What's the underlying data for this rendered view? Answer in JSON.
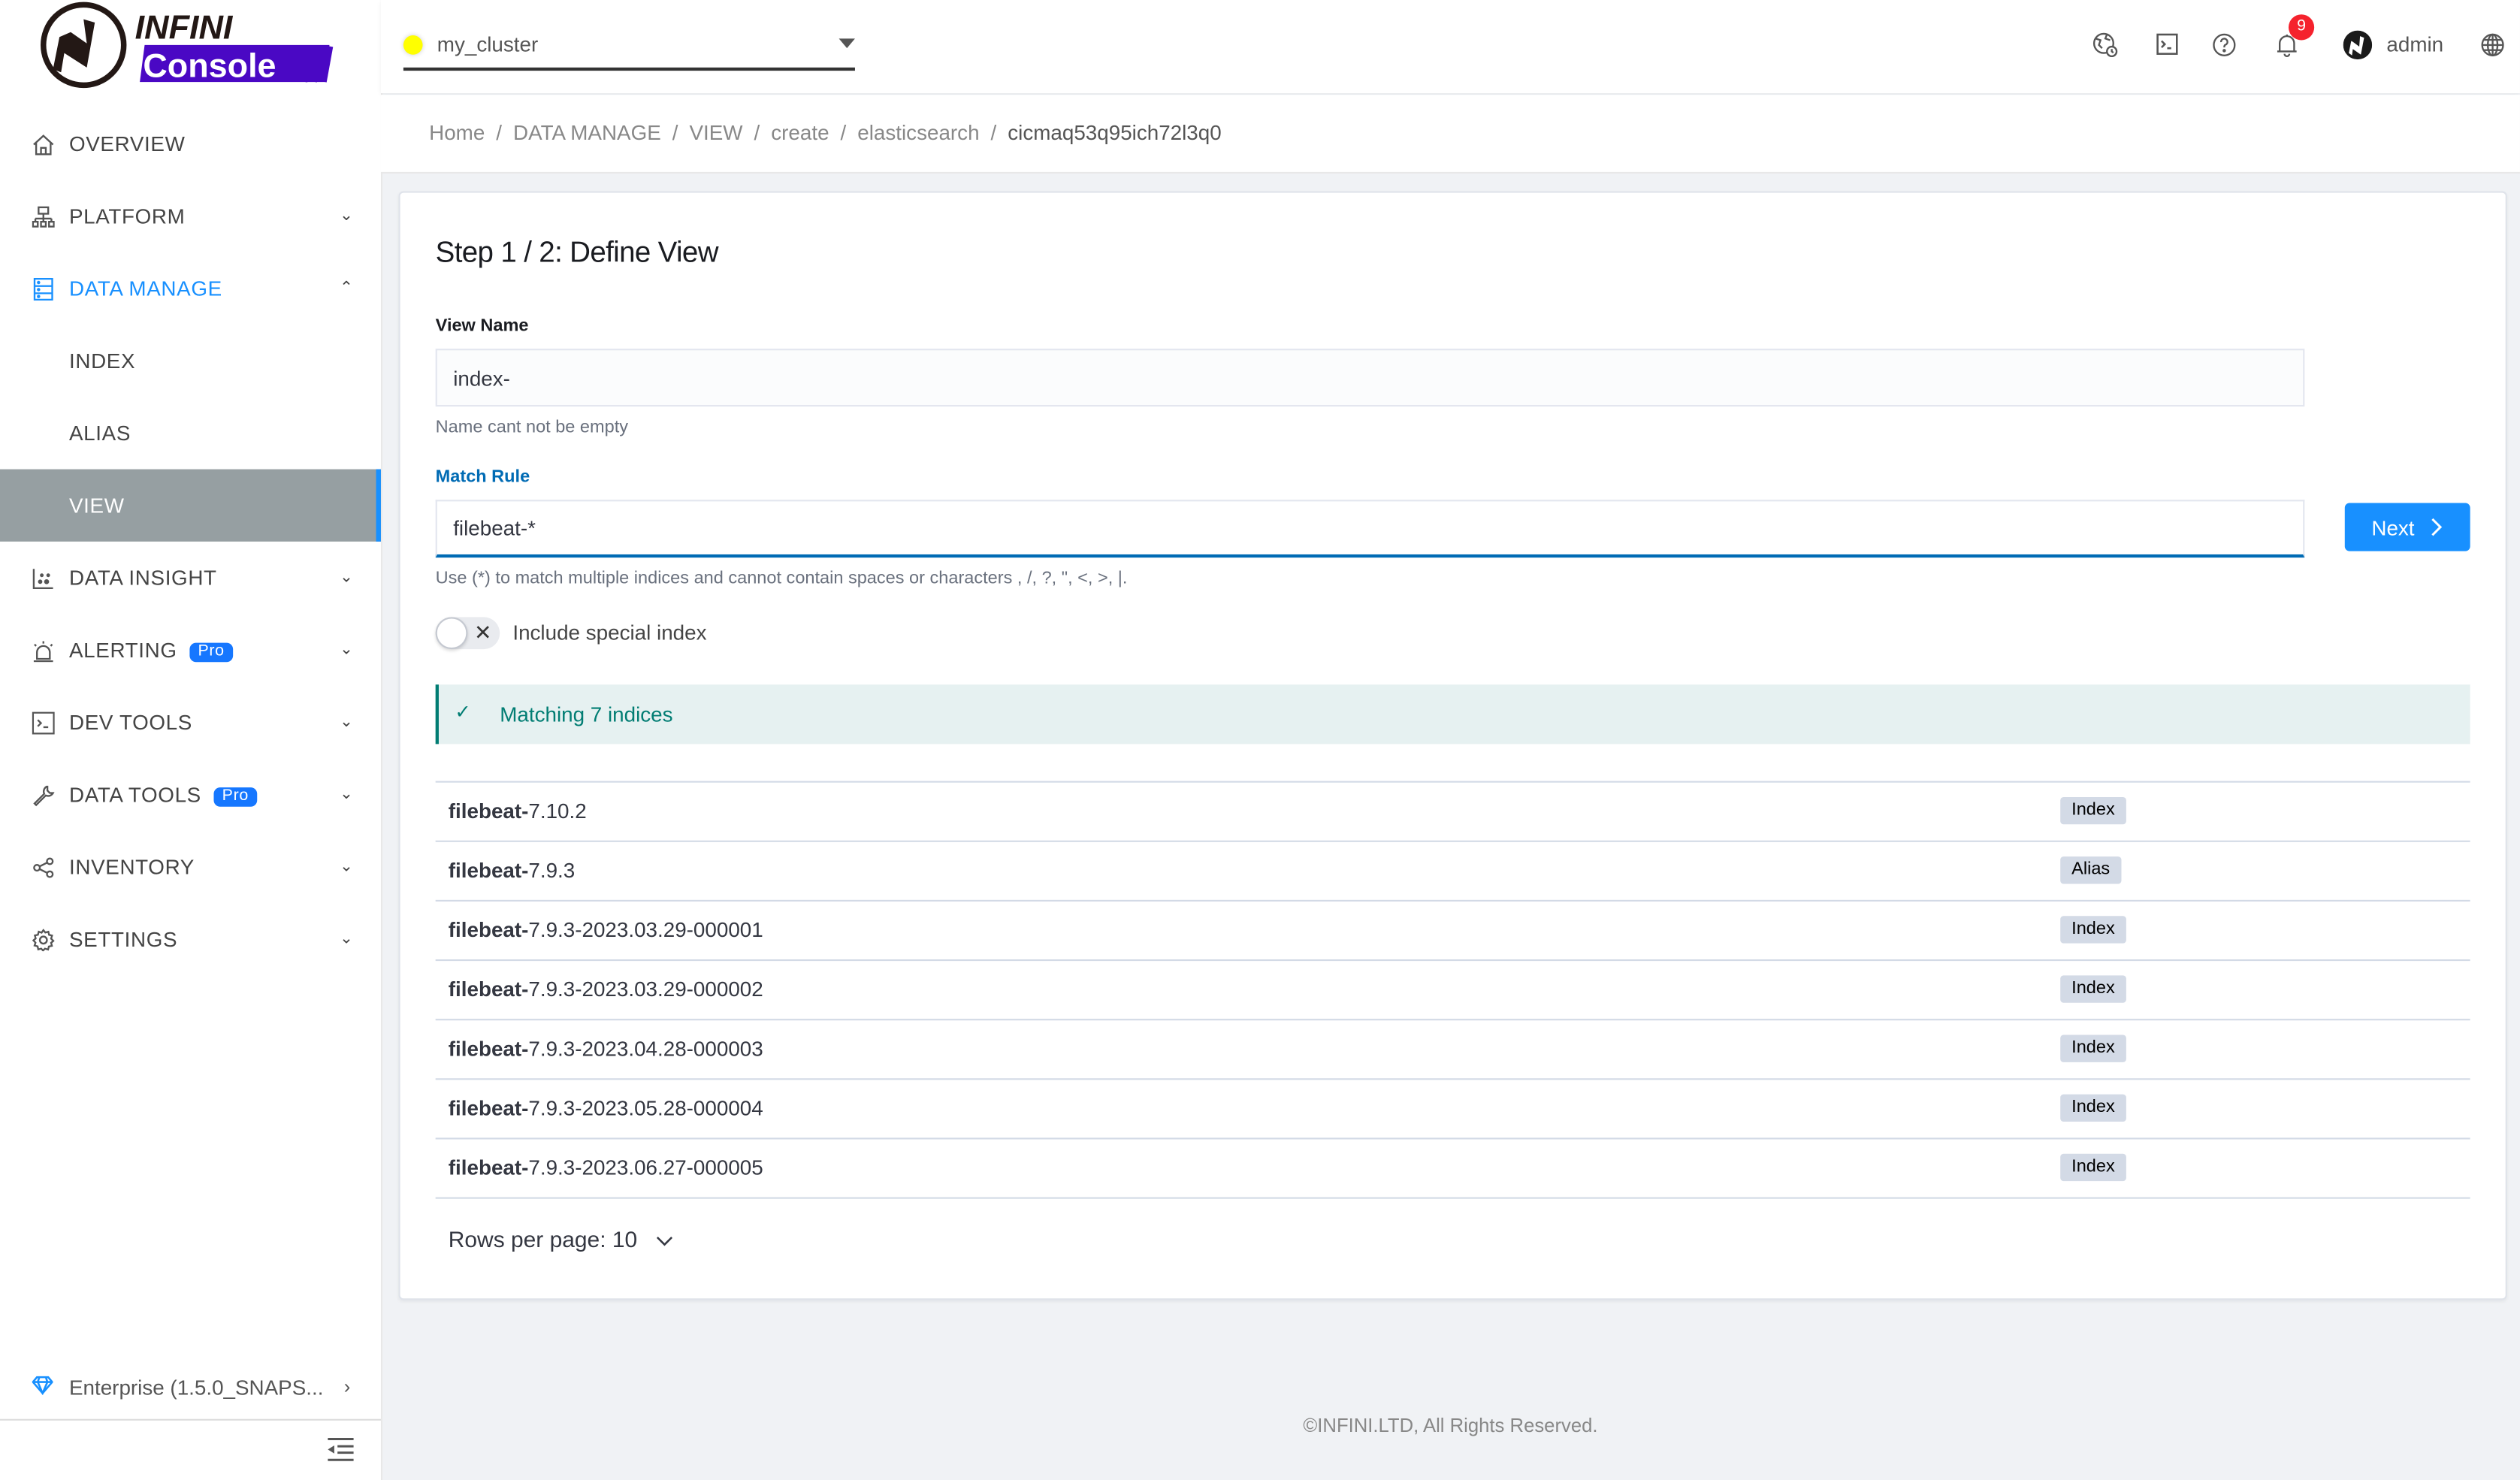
{
  "app": {
    "logo_top": "INFINI",
    "logo_bottom": "Console"
  },
  "header": {
    "cluster_name": "my_cluster",
    "cluster_status_color": "#ffff00",
    "notification_count": "9",
    "user_name": "admin",
    "icons": [
      "global-clock-icon",
      "terminal-icon",
      "help-icon",
      "bell-icon",
      "avatar",
      "language-icon"
    ]
  },
  "breadcrumb": {
    "items": [
      "Home",
      "DATA MANAGE",
      "VIEW",
      "create",
      "elasticsearch"
    ],
    "current": "cicmaq53q95ich72l3q0",
    "separator": "/"
  },
  "sidebar": {
    "items": [
      {
        "label": "OVERVIEW",
        "icon": "home-icon"
      },
      {
        "label": "PLATFORM",
        "icon": "cluster-icon"
      },
      {
        "label": "DATA MANAGE",
        "icon": "database-icon"
      },
      {
        "label": "INDEX"
      },
      {
        "label": "ALIAS"
      },
      {
        "label": "VIEW"
      },
      {
        "label": "DATA INSIGHT",
        "icon": "chart-icon"
      },
      {
        "label": "ALERTING",
        "icon": "alarm-icon",
        "badge": "Pro"
      },
      {
        "label": "DEV TOOLS",
        "icon": "terminal-icon"
      },
      {
        "label": "DATA TOOLS",
        "icon": "wrench-icon",
        "badge": "Pro"
      },
      {
        "label": "INVENTORY",
        "icon": "share-icon"
      },
      {
        "label": "SETTINGS",
        "icon": "gear-icon"
      }
    ],
    "edition": "Enterprise (1.5.0_SNAPS...",
    "accent": "#1890ff",
    "active_bg": "#969fa2"
  },
  "form": {
    "title": "Step 1 / 2: Define View",
    "view_name_label": "View Name",
    "view_name_value": "index-",
    "view_name_help": "Name cant not be empty",
    "match_rule_label": "Match Rule",
    "match_rule_value": "filebeat-*",
    "match_rule_help": "Use (*) to match multiple indices and cannot contain spaces or characters , /, ?, \", <, >, |.",
    "next_label": "Next",
    "toggle_label": "Include special index",
    "toggle_on": false,
    "match_status": "Matching 7 indices"
  },
  "indices": [
    {
      "prefix": "filebeat-",
      "rest": "7.10.2",
      "type": "Index"
    },
    {
      "prefix": "filebeat-",
      "rest": "7.9.3",
      "type": "Alias"
    },
    {
      "prefix": "filebeat-",
      "rest": "7.9.3-2023.03.29-000001",
      "type": "Index"
    },
    {
      "prefix": "filebeat-",
      "rest": "7.9.3-2023.03.29-000002",
      "type": "Index"
    },
    {
      "prefix": "filebeat-",
      "rest": "7.9.3-2023.04.28-000003",
      "type": "Index"
    },
    {
      "prefix": "filebeat-",
      "rest": "7.9.3-2023.05.28-000004",
      "type": "Index"
    },
    {
      "prefix": "filebeat-",
      "rest": "7.9.3-2023.06.27-000005",
      "type": "Index"
    }
  ],
  "pagination": {
    "rows_per_page_label": "Rows per page: 10"
  },
  "footer": {
    "text": "©INFINI.LTD, All Rights Reserved."
  }
}
